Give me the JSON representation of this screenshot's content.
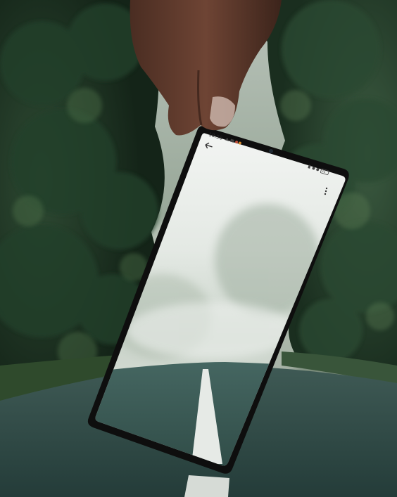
{
  "phone": {
    "status_time": "10:56",
    "status_icons": [
      "wifi-icon",
      "signal-icon",
      "app-icon",
      "app-icon"
    ],
    "status_right_icons": [
      "sim-icon",
      "silent-icon",
      "moon-icon",
      "battery-icon"
    ],
    "battery_label": "25",
    "back_icon": "back-arrow-icon",
    "menu_icon": "kebab-menu-icon"
  },
  "colors": {
    "road": "#33504b",
    "forest_dark": "#1e3326",
    "mist": "#e6ebe6",
    "phone_frame": "#111111"
  }
}
